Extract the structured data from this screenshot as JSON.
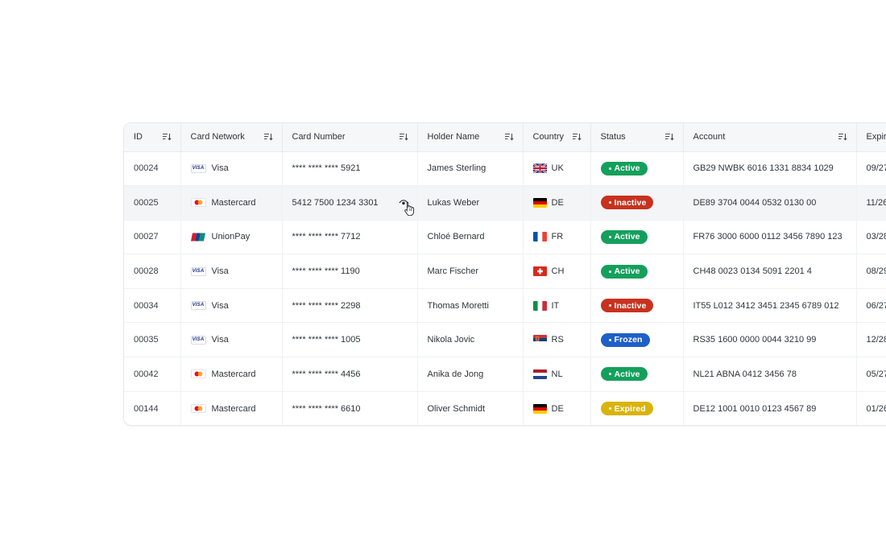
{
  "table": {
    "headers": {
      "id": "ID",
      "network": "Card Network",
      "number": "Card Number",
      "holder": "Holder Name",
      "country": "Country",
      "status": "Status",
      "account": "Account",
      "expiry": "Expiry"
    },
    "rows": [
      {
        "id": "00024",
        "network": "Visa",
        "network_logo": "visa",
        "number": "**** **** **** 5921",
        "holder": "James Sterling",
        "flag": "gb-flag",
        "country": "UK",
        "status": "Active",
        "status_color": "#14a05c",
        "account": "GB29 NWBK 6016 1331 8834 1029",
        "expiry": "09/27"
      },
      {
        "id": "00025",
        "network": "Mastercard",
        "network_logo": "mastercard",
        "number": "5412 7500 1234 3301",
        "holder": "Lukas Weber",
        "flag": "de-flag",
        "country": "DE",
        "status": "Inactive",
        "status_color": "#c7321e",
        "account": "DE89 3704 0044 0532 0130 00",
        "expiry": "11/26"
      },
      {
        "id": "00027",
        "network": "UnionPay",
        "network_logo": "unionpay",
        "number": "**** **** **** 7712",
        "holder": "Chloé Bernard",
        "flag": "fr-flag",
        "country": "FR",
        "status": "Active",
        "status_color": "#14a05c",
        "account": "FR76 3000 6000 0112 3456 7890 123",
        "expiry": "03/28"
      },
      {
        "id": "00028",
        "network": "Visa",
        "network_logo": "visa",
        "number": "**** **** **** 1190",
        "holder": "Marc Fischer",
        "flag": "ch-flag",
        "country": "CH",
        "status": "Active",
        "status_color": "#14a05c",
        "account": "CH48 0023 0134 5091 2201 4",
        "expiry": "08/29"
      },
      {
        "id": "00034",
        "network": "Visa",
        "network_logo": "visa",
        "number": "**** **** **** 2298",
        "holder": "Thomas Moretti",
        "flag": "it-flag",
        "country": "IT",
        "status": "Inactive",
        "status_color": "#c7321e",
        "account": "IT55 L012 3412 3451 2345 6789 012",
        "expiry": "06/27"
      },
      {
        "id": "00035",
        "network": "Visa",
        "network_logo": "visa",
        "number": "**** **** **** 1005",
        "holder": "Nikola Jovic",
        "flag": "rs-flag",
        "country": "RS",
        "status": "Frozen",
        "status_color": "#1e5fc8",
        "account": "RS35 1600 0000 0044 3210 99",
        "expiry": "12/28"
      },
      {
        "id": "00042",
        "network": "Mastercard",
        "network_logo": "mastercard",
        "number": "**** **** **** 4456",
        "holder": "Anika de Jong",
        "flag": "nl-flag",
        "country": "NL",
        "status": "Active",
        "status_color": "#14a05c",
        "account": "NL21 ABNA 0412 3456 78",
        "expiry": "05/27"
      },
      {
        "id": "00144",
        "network": "Mastercard",
        "network_logo": "mastercard",
        "number": "**** **** **** 6610",
        "holder": "Oliver Schmidt",
        "flag": "de-flag",
        "country": "DE",
        "status": "Expired",
        "status_color": "#d9b30e",
        "account": "DE12 1001 0010 0123 4567 89",
        "expiry": "01/26"
      }
    ],
    "visa_logo_text": "VISA"
  }
}
